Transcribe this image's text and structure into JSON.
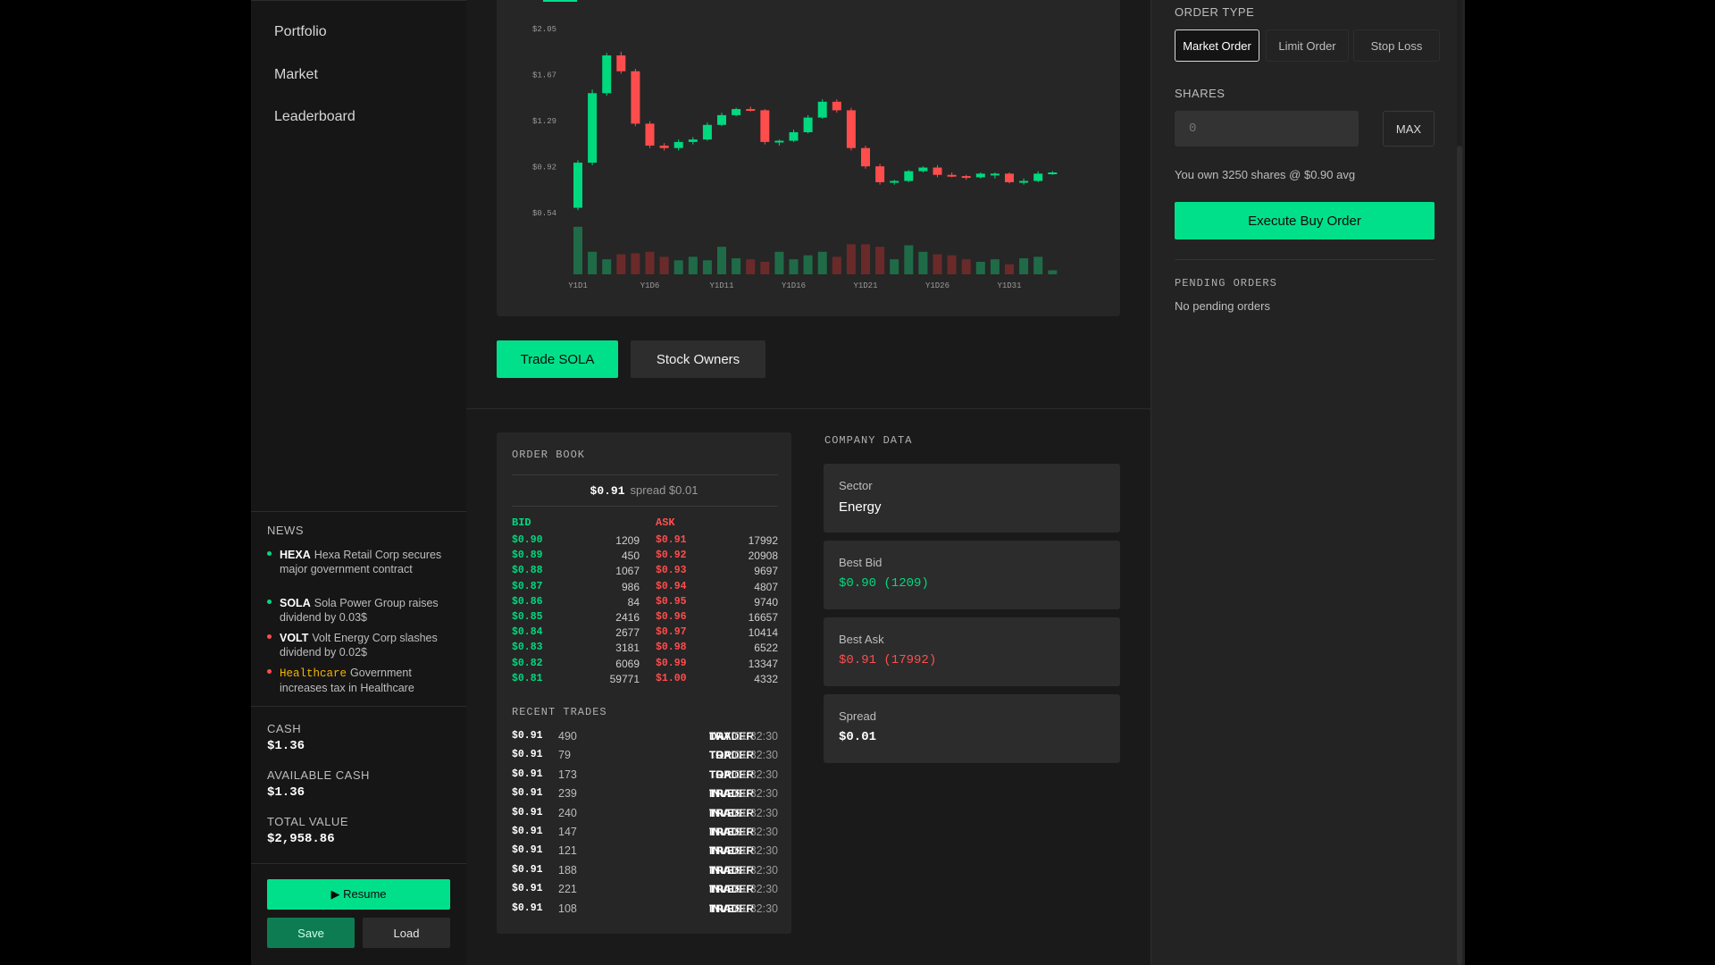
{
  "sidebar": {
    "nav": [
      "Portfolio",
      "Market",
      "Leaderboard"
    ],
    "news_title": "NEWS",
    "news": [
      {
        "ticker": "HEXA",
        "text": "Hexa Retail Corp secures major government contract",
        "color": "#00d97e"
      },
      {
        "ticker": "SOLA",
        "text": "Sola Power Group raises dividend by 0.03$",
        "color": "#00d97e"
      },
      {
        "ticker": "VOLT",
        "text": "Volt Energy Corp slashes dividend by 0.02$",
        "color": "#ff4d4d"
      },
      {
        "ticker": "Healthcare",
        "text": "Government increases tax in Healthcare",
        "color": "#ff4d4d"
      }
    ],
    "cash_label": "CASH",
    "cash_value": "$1.36",
    "available_label": "AVAILABLE CASH",
    "available_value": "$1.36",
    "total_label": "TOTAL VALUE",
    "total_value": "$2,958.86",
    "resume_label": "▶ Resume",
    "save_label": "Save",
    "load_label": "Load"
  },
  "chart_data": {
    "type": "candlestick",
    "y_ticks": [
      "$2.05",
      "$1.67",
      "$1.29",
      "$0.92",
      "$0.54"
    ],
    "x_ticks": [
      "Y1D1",
      "Y1D6",
      "Y1D11",
      "Y1D16",
      "Y1D21",
      "Y1D26",
      "Y1D31"
    ],
    "ylim": [
      0.54,
      2.05
    ],
    "candles": [
      {
        "o": 0.58,
        "h": 0.97,
        "l": 0.56,
        "c": 0.95
      },
      {
        "o": 0.95,
        "h": 1.55,
        "l": 0.93,
        "c": 1.52
      },
      {
        "o": 1.52,
        "h": 1.85,
        "l": 1.5,
        "c": 1.83
      },
      {
        "o": 1.83,
        "h": 1.86,
        "l": 1.68,
        "c": 1.7
      },
      {
        "o": 1.7,
        "h": 1.72,
        "l": 1.25,
        "c": 1.27
      },
      {
        "o": 1.27,
        "h": 1.29,
        "l": 1.07,
        "c": 1.09
      },
      {
        "o": 1.09,
        "h": 1.11,
        "l": 1.05,
        "c": 1.07
      },
      {
        "o": 1.07,
        "h": 1.14,
        "l": 1.05,
        "c": 1.12
      },
      {
        "o": 1.12,
        "h": 1.16,
        "l": 1.1,
        "c": 1.14
      },
      {
        "o": 1.14,
        "h": 1.28,
        "l": 1.13,
        "c": 1.26
      },
      {
        "o": 1.26,
        "h": 1.36,
        "l": 1.25,
        "c": 1.34
      },
      {
        "o": 1.34,
        "h": 1.4,
        "l": 1.33,
        "c": 1.39
      },
      {
        "o": 1.39,
        "h": 1.41,
        "l": 1.37,
        "c": 1.38
      },
      {
        "o": 1.38,
        "h": 1.39,
        "l": 1.1,
        "c": 1.12
      },
      {
        "o": 1.12,
        "h": 1.14,
        "l": 1.09,
        "c": 1.13
      },
      {
        "o": 1.13,
        "h": 1.22,
        "l": 1.12,
        "c": 1.2
      },
      {
        "o": 1.2,
        "h": 1.34,
        "l": 1.19,
        "c": 1.32
      },
      {
        "o": 1.32,
        "h": 1.47,
        "l": 1.31,
        "c": 1.45
      },
      {
        "o": 1.45,
        "h": 1.47,
        "l": 1.36,
        "c": 1.38
      },
      {
        "o": 1.38,
        "h": 1.4,
        "l": 1.05,
        "c": 1.07
      },
      {
        "o": 1.07,
        "h": 1.09,
        "l": 0.9,
        "c": 0.92
      },
      {
        "o": 0.92,
        "h": 0.94,
        "l": 0.77,
        "c": 0.79
      },
      {
        "o": 0.79,
        "h": 0.81,
        "l": 0.77,
        "c": 0.8
      },
      {
        "o": 0.8,
        "h": 0.89,
        "l": 0.79,
        "c": 0.88
      },
      {
        "o": 0.88,
        "h": 0.92,
        "l": 0.87,
        "c": 0.91
      },
      {
        "o": 0.91,
        "h": 0.93,
        "l": 0.83,
        "c": 0.85
      },
      {
        "o": 0.85,
        "h": 0.87,
        "l": 0.83,
        "c": 0.84
      },
      {
        "o": 0.84,
        "h": 0.85,
        "l": 0.81,
        "c": 0.83
      },
      {
        "o": 0.83,
        "h": 0.87,
        "l": 0.82,
        "c": 0.86
      },
      {
        "o": 0.86,
        "h": 0.87,
        "l": 0.82,
        "c": 0.86
      },
      {
        "o": 0.86,
        "h": 0.87,
        "l": 0.78,
        "c": 0.79
      },
      {
        "o": 0.79,
        "h": 0.82,
        "l": 0.77,
        "c": 0.8
      },
      {
        "o": 0.8,
        "h": 0.88,
        "l": 0.79,
        "c": 0.86
      },
      {
        "o": 0.86,
        "h": 0.88,
        "l": 0.85,
        "c": 0.87
      }
    ],
    "volumes": [
      0.95,
      0.45,
      0.3,
      0.4,
      0.42,
      0.45,
      0.35,
      0.28,
      0.35,
      0.28,
      0.55,
      0.32,
      0.3,
      0.25,
      0.45,
      0.3,
      0.38,
      0.45,
      0.35,
      0.6,
      0.6,
      0.55,
      0.3,
      0.58,
      0.45,
      0.4,
      0.38,
      0.3,
      0.25,
      0.3,
      0.2,
      0.32,
      0.35,
      0.08
    ]
  },
  "tabs": {
    "trade": "Trade SOLA",
    "owners": "Stock Owners"
  },
  "order_book": {
    "title": "ORDER BOOK",
    "mid_price": "$0.91",
    "spread_text": "spread $0.01",
    "bid_head": "BID",
    "ask_head": "ASK",
    "rows": [
      {
        "bid": "$0.90",
        "bq": "1209",
        "ask": "$0.91",
        "aq": "17992"
      },
      {
        "bid": "$0.89",
        "bq": "450",
        "ask": "$0.92",
        "aq": "20908"
      },
      {
        "bid": "$0.88",
        "bq": "1067",
        "ask": "$0.93",
        "aq": "9697"
      },
      {
        "bid": "$0.87",
        "bq": "986",
        "ask": "$0.94",
        "aq": "4807"
      },
      {
        "bid": "$0.86",
        "bq": "84",
        "ask": "$0.95",
        "aq": "9740"
      },
      {
        "bid": "$0.85",
        "bq": "2416",
        "ask": "$0.96",
        "aq": "16657"
      },
      {
        "bid": "$0.84",
        "bq": "2677",
        "ask": "$0.97",
        "aq": "10414"
      },
      {
        "bid": "$0.83",
        "bq": "3181",
        "ask": "$0.98",
        "aq": "6522"
      },
      {
        "bid": "$0.82",
        "bq": "6069",
        "ask": "$0.99",
        "aq": "13347"
      },
      {
        "bid": "$0.81",
        "bq": "59771",
        "ask": "$1.00",
        "aq": "4332"
      }
    ],
    "recent_title": "RECENT TRADES",
    "trades": [
      {
        "price": "$0.91",
        "qty": "490",
        "from": "DAY",
        "to": "TRADER",
        "time": "01:32:30"
      },
      {
        "price": "$0.91",
        "qty": "79",
        "from": "TOR",
        "to": "TRADER",
        "time": "01:32:30"
      },
      {
        "price": "$0.91",
        "qty": "173",
        "from": "TOR",
        "to": "TRADER",
        "time": "01:32:30"
      },
      {
        "price": "$0.91",
        "qty": "239",
        "from": "INVES",
        "to": "TRADER",
        "time": "01:32:30"
      },
      {
        "price": "$0.91",
        "qty": "240",
        "from": "INVES",
        "to": "TRADER",
        "time": "01:32:30"
      },
      {
        "price": "$0.91",
        "qty": "147",
        "from": "INVES",
        "to": "TRADER",
        "time": "01:32:30"
      },
      {
        "price": "$0.91",
        "qty": "121",
        "from": "INVES",
        "to": "TRADER",
        "time": "01:32:30"
      },
      {
        "price": "$0.91",
        "qty": "188",
        "from": "INVES",
        "to": "TRADER",
        "time": "01:32:30"
      },
      {
        "price": "$0.91",
        "qty": "221",
        "from": "INVES",
        "to": "TRADER",
        "time": "01:32:30"
      },
      {
        "price": "$0.91",
        "qty": "108",
        "from": "INVES",
        "to": "TRADER",
        "time": "01:32:30"
      }
    ]
  },
  "company": {
    "title": "COMPANY DATA",
    "sector_label": "Sector",
    "sector_value": "Energy",
    "bid_label": "Best Bid",
    "bid_value": "$0.90 (1209)",
    "ask_label": "Best Ask",
    "ask_value": "$0.91 (17992)",
    "spread_label": "Spread",
    "spread_value": "$0.01"
  },
  "order_panel": {
    "order_type_label": "ORDER TYPE",
    "types": [
      "Market Order",
      "Limit Order",
      "Stop Loss"
    ],
    "shares_label": "SHARES",
    "shares_placeholder": "0",
    "max_label": "MAX",
    "own_text": "You own 3250 shares @ $0.90 avg",
    "execute_label": "Execute Buy Order",
    "pending_title": "PENDING ORDERS",
    "pending_text": "No pending orders"
  },
  "colors": {
    "up": "#00d97e",
    "down": "#ff4d4d",
    "accent": "#00e08a"
  }
}
